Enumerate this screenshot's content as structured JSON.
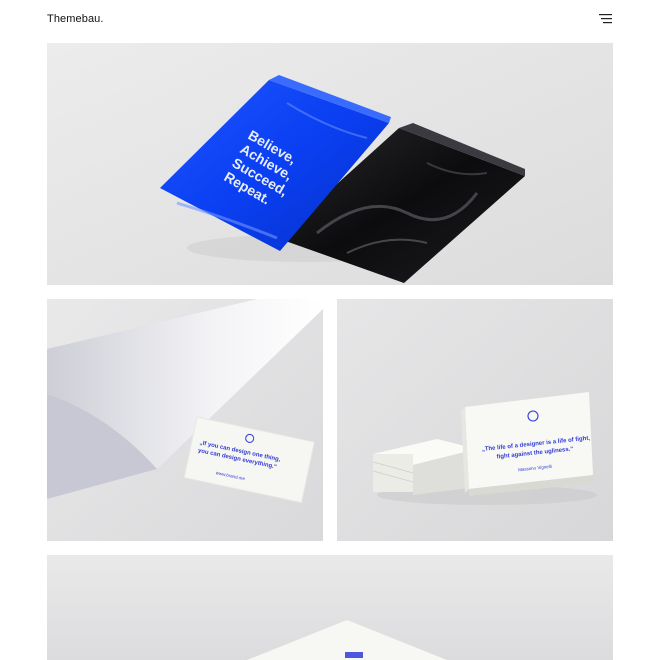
{
  "header": {
    "logo": "Themebau.",
    "menu_icon": "hamburger-menu-icon"
  },
  "gallery": {
    "hero": {
      "pouch_text": [
        "Believe,",
        "Achieve,",
        "Succeed,",
        "Repeat."
      ],
      "colors": {
        "blue": "#0a3ff2",
        "black": "#0c0c0e"
      }
    },
    "left": {
      "card_quote": [
        "„If you can design one thing,",
        "you can design everything.“"
      ],
      "card_url": "www.brand.me"
    },
    "right": {
      "card_quote": [
        "„The life of a designer is a life of fight,",
        "fight against the ugliness.“"
      ],
      "card_author": "Massimo Vignelli"
    }
  },
  "colors": {
    "accent": "#2f3bd8",
    "background": "#ffffff",
    "photo_bg": "#e4e4e4"
  }
}
